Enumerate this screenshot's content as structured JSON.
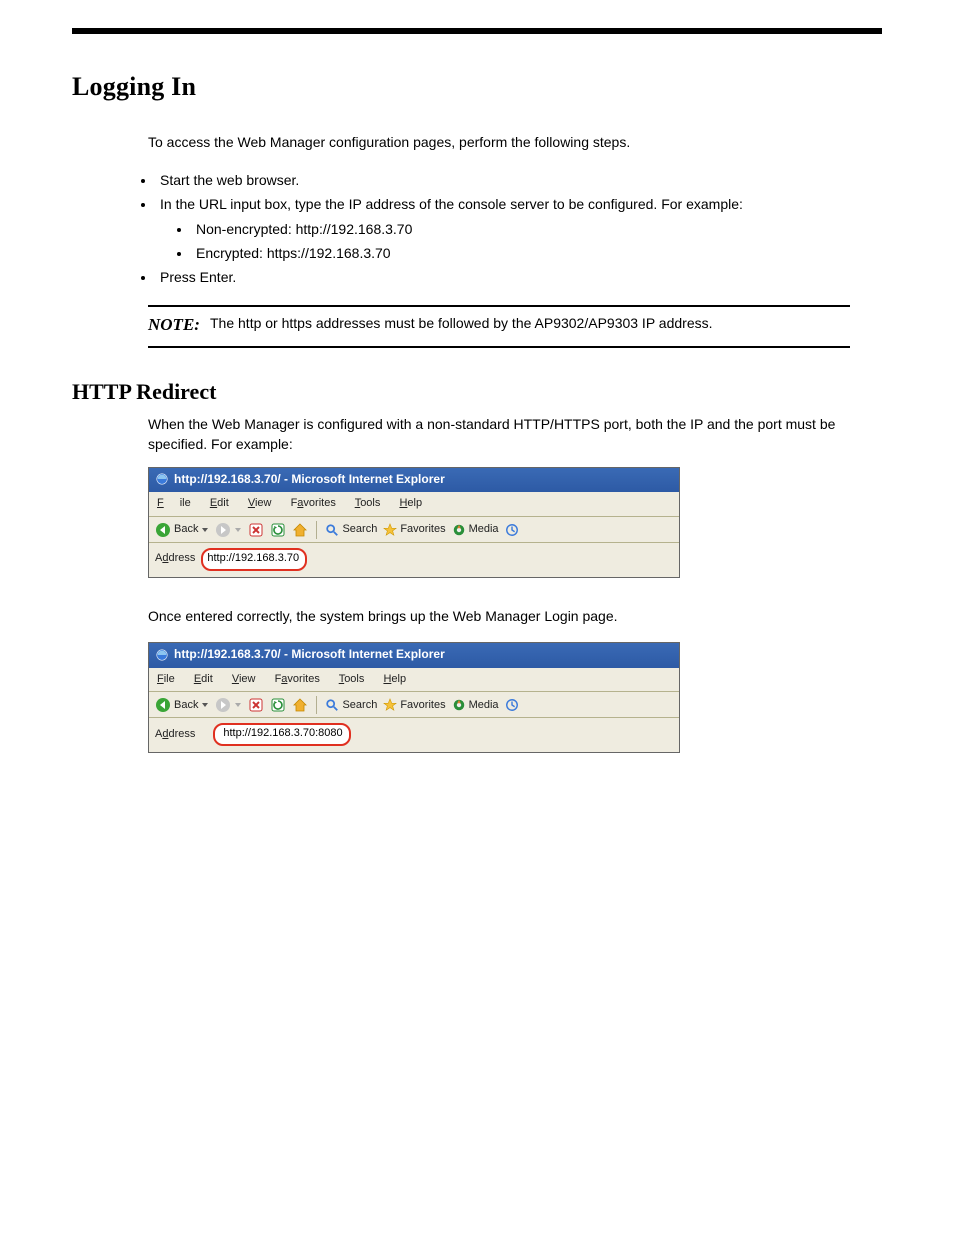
{
  "page_title": "Logging In",
  "intro": "To access the Web Manager configuration pages, perform the following steps.",
  "steps": {
    "items": [
      {
        "text": "Start the web browser."
      },
      {
        "text": "In the URL input box, type the IP address of the console server to be configured. For example:",
        "sub": [
          {
            "text": "Non-encrypted: http://192.168.3.70"
          },
          {
            "text": "Encrypted: https://192.168.3.70"
          }
        ]
      },
      {
        "text": "Press Enter."
      }
    ]
  },
  "note_label": "NOTE:",
  "note_text": "The http or https addresses must be followed by the AP9302/AP9303 IP address.",
  "section_heading": "HTTP Redirect",
  "section_p1": "When the Web Manager is configured with a non-standard HTTP/HTTPS port, both the IP and the port must be specified. For example:",
  "section_p2": "Once entered correctly, the system brings up the Web Manager Login page.",
  "ie_window_1": {
    "title": "http://192.168.3.70/ - Microsoft Internet Explorer",
    "menu": {
      "file": "File",
      "edit": "Edit",
      "view": "View",
      "favorites": "Favorites",
      "tools": "Tools",
      "help": "Help"
    },
    "toolbar": {
      "back": "Back",
      "search": "Search",
      "favorites": "Favorites",
      "media": "Media"
    },
    "address_label": "Address",
    "address_url": "http://192.168.3.70",
    "show_small_ie_logo": true
  },
  "ie_window_2": {
    "title": "http://192.168.3.70/ - Microsoft Internet Explorer",
    "menu": {
      "file": "File",
      "edit": "Edit",
      "view": "View",
      "favorites": "Favorites",
      "tools": "Tools",
      "help": "Help"
    },
    "toolbar": {
      "back": "Back",
      "search": "Search",
      "favorites": "Favorites",
      "media": "Media"
    },
    "address_label": "Address",
    "address_url": "http://192.168.3.70:8080",
    "show_small_ie_logo": false
  }
}
